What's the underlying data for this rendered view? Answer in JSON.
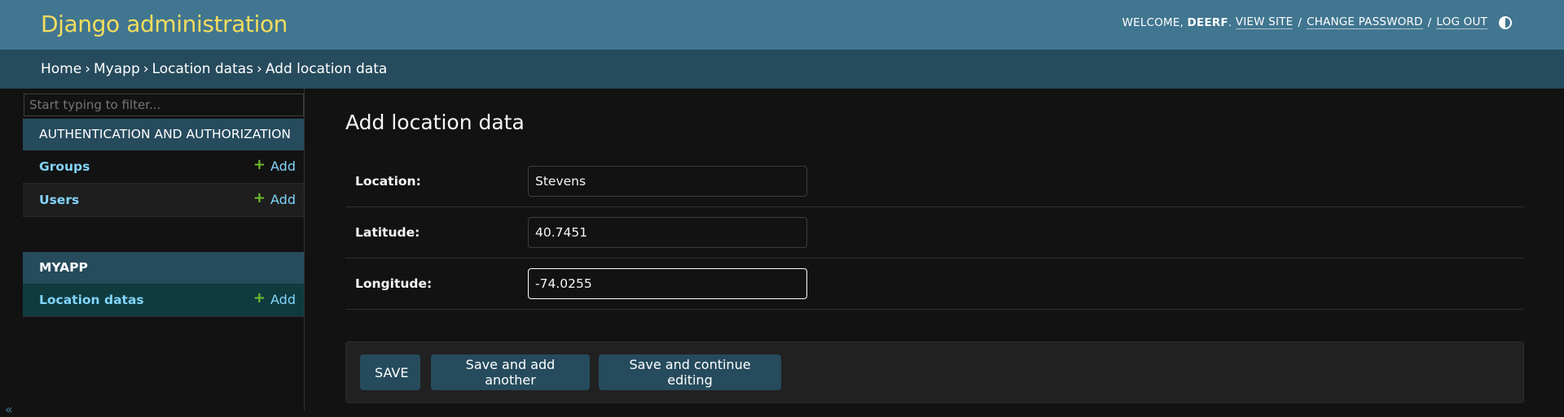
{
  "header": {
    "branding": "Django administration",
    "welcome_prefix": "WELCOME,",
    "username": "DEERF",
    "view_site": "VIEW SITE",
    "change_password": "CHANGE PASSWORD",
    "log_out": "LOG OUT",
    "separator": "/"
  },
  "breadcrumbs": {
    "items": [
      "Home",
      "Myapp",
      "Location datas",
      "Add location data"
    ],
    "separator": "›"
  },
  "sidebar": {
    "filter_placeholder": "Start typing to filter...",
    "modules": [
      {
        "caption": "AUTHENTICATION AND AUTHORIZATION",
        "models": [
          {
            "name": "Groups",
            "add_label": "Add"
          },
          {
            "name": "Users",
            "add_label": "Add"
          }
        ]
      },
      {
        "caption": "MYAPP",
        "models": [
          {
            "name": "Location datas",
            "add_label": "Add"
          }
        ]
      }
    ],
    "collapse_glyph": "«"
  },
  "content": {
    "title": "Add location data",
    "fields": [
      {
        "label": "Location:",
        "value": "Stevens"
      },
      {
        "label": "Latitude:",
        "value": "40.7451"
      },
      {
        "label": "Longitude:",
        "value": "-74.0255"
      }
    ],
    "buttons": {
      "save": "SAVE",
      "save_add_another": "Save and add another",
      "save_continue": "Save and continue editing"
    }
  },
  "colors": {
    "header_bg": "#417690",
    "branding": "#f5dd5d",
    "breadcrumbs_bg": "#264b5d",
    "link": "#81d4fa",
    "add_icon": "#70bf2b",
    "body_bg": "#121212"
  }
}
